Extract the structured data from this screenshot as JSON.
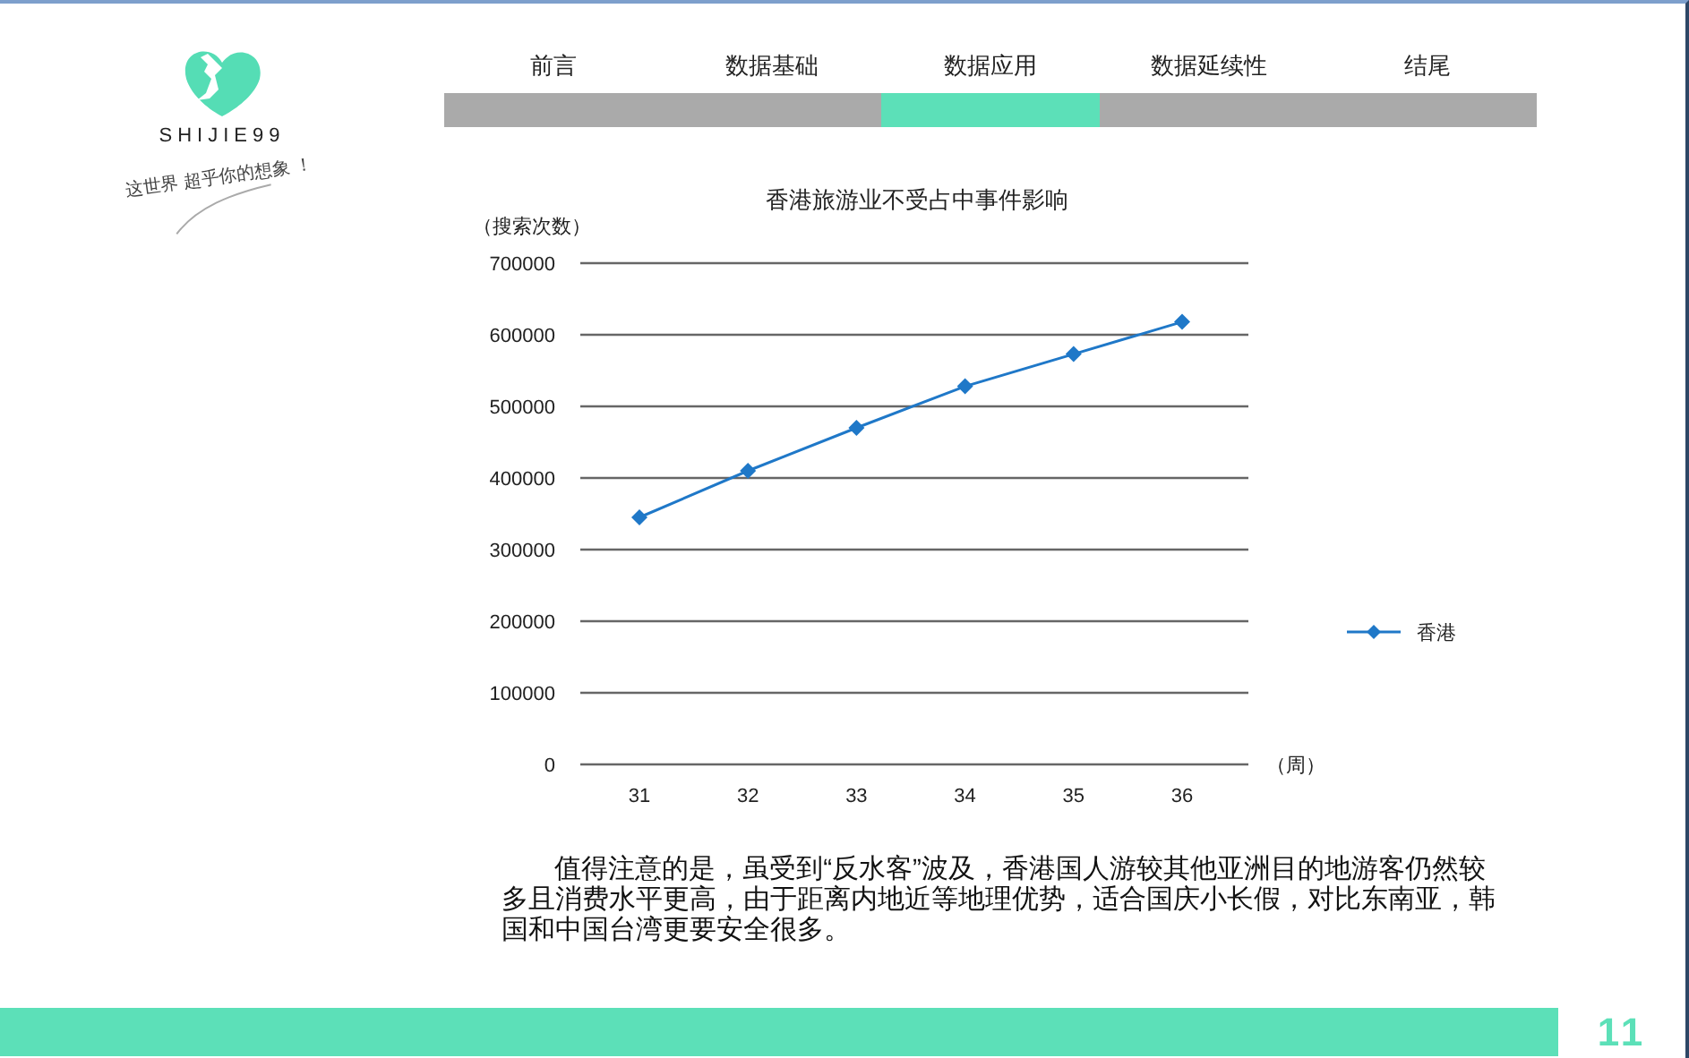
{
  "logo": {
    "brand": "SHIJIE99",
    "slogan": "这世界 超乎你的想象 ！"
  },
  "tabs": [
    {
      "label": "前言",
      "selected": false
    },
    {
      "label": "数据基础",
      "selected": false
    },
    {
      "label": "数据应用",
      "selected": true
    },
    {
      "label": "数据延续性",
      "selected": false
    },
    {
      "label": "结尾",
      "selected": false
    }
  ],
  "chart": {
    "chart_data": {
      "type": "line",
      "grid": true,
      "title": "香港旅游业不受占中事件影响",
      "ylabel": "（搜索次数）",
      "xlabel": "（周）",
      "categories": [
        "31",
        "32",
        "33",
        "34",
        "35",
        "36"
      ],
      "ylim": [
        0,
        700000
      ],
      "yticks": [
        {
          "value": 0,
          "label": "0"
        },
        {
          "value": 100000,
          "label": "100000"
        },
        {
          "value": 200000,
          "label": "200000"
        },
        {
          "value": 300000,
          "label": "300000"
        },
        {
          "value": 400000,
          "label": "400000"
        },
        {
          "value": 500000,
          "label": "500000"
        },
        {
          "value": 600000,
          "label": "600000"
        },
        {
          "value": 700000,
          "label": "700000"
        }
      ],
      "series": [
        {
          "name": "香港",
          "color": "#1f78c8",
          "marker": "diamond",
          "values": [
            345000,
            410000,
            470000,
            528000,
            573000,
            618000
          ]
        }
      ]
    }
  },
  "note": "值得注意的是，虽受到“反水客”波及，香港国人游较其他亚洲目的地游客仍然较多且消费水平更高，由于距离内地近等地理优势，适合国庆小长假，对比东南亚，韩国和中国台湾更要安全很多。",
  "page_number": "11"
}
